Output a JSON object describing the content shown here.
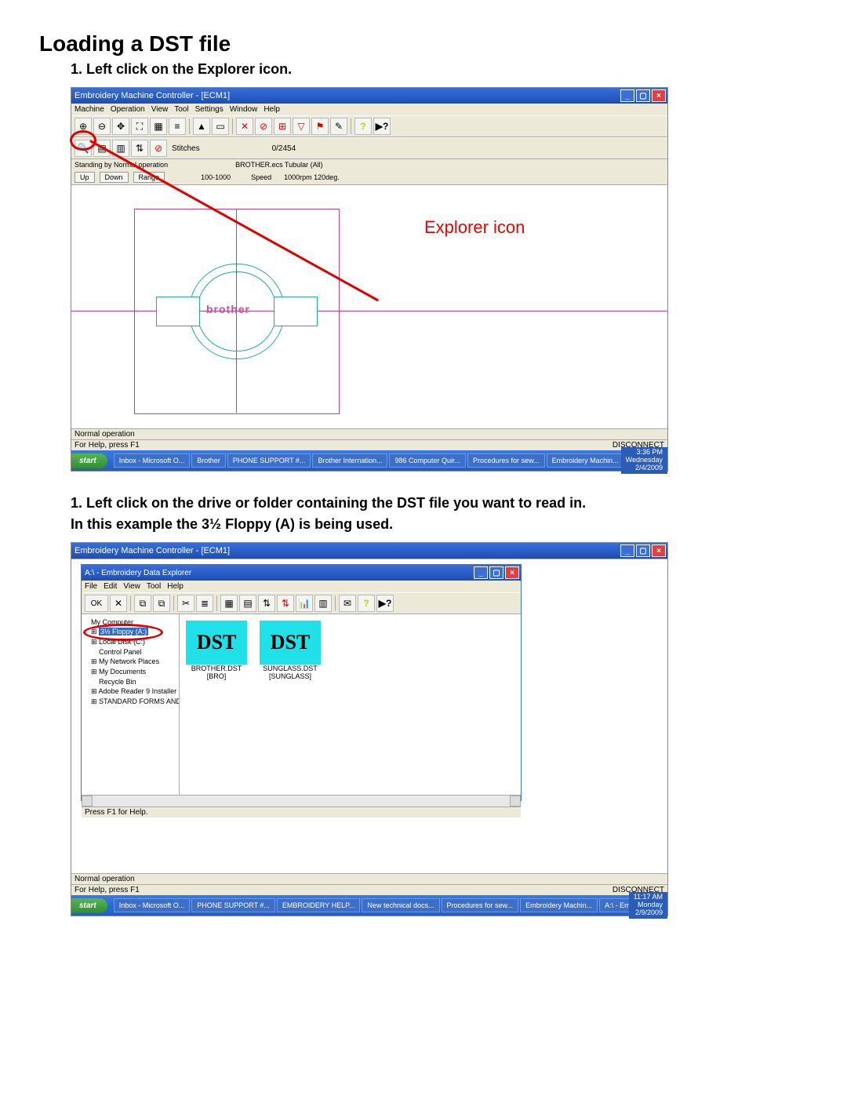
{
  "doc": {
    "title": "Loading a DST file",
    "step1": "1. Left click on the Explorer icon.",
    "step2a": "1. Left click on the drive or folder containing the DST file you want to read in.",
    "step2b": "In this example the 3½ Floppy (A) is being used."
  },
  "callout": {
    "explorer": "Explorer icon"
  },
  "shot1": {
    "title": "Embroidery Machine Controller - [ECM1]",
    "menus": [
      "Machine",
      "Operation",
      "View",
      "Tool",
      "Settings",
      "Window",
      "Help"
    ],
    "stitches_label": "Stitches",
    "stitches_value": "0/2454",
    "standing": "Standing by    Normal operation",
    "machine": "BROTHER.ecs Tubular (All)",
    "buttons": {
      "up": "Up",
      "down": "Down",
      "range": "Range"
    },
    "rpm_range": "100-1000",
    "speed_label": "Speed",
    "speed_value": "1000rpm 120deg.",
    "logo": "brother",
    "status1": "Normal operation",
    "status2": "For Help, press F1",
    "disconnect": "DISCONNECT"
  },
  "taskbar1": {
    "start": "start",
    "items": [
      "Inbox - Microsoft O...",
      "Brother",
      "PHONE SUPPORT #...",
      "Brother Internation...",
      "986 Computer Quir...",
      "Procedures for sew...",
      "Embroidery Machin..."
    ],
    "clock": {
      "time": "3:36 PM",
      "day": "Wednesday",
      "date": "2/4/2009"
    }
  },
  "shot2": {
    "outer_title": "Embroidery Machine Controller - [ECM1]",
    "inner_title": "A:\\ - Embroidery Data Explorer",
    "menus": [
      "File",
      "Edit",
      "View",
      "Tool",
      "Help"
    ],
    "ok": "OK",
    "tree": {
      "root": "My Computer",
      "floppy": "3½ Floppy (A:)",
      "local": "Local Disk (C:)",
      "panel": "Control Panel",
      "net": "My Network Places",
      "docs": "My Documents",
      "bin": "Recycle Bin",
      "adobe": "Adobe Reader 9 Installer",
      "forms": "STANDARD FORMS AND TEMPLAT"
    },
    "files": [
      {
        "icon": "DST",
        "name": "BROTHER.DST",
        "sub": "[BRO]"
      },
      {
        "icon": "DST",
        "name": "SUNGLASS.DST",
        "sub": "[SUNGLASS]"
      }
    ],
    "status": "Press F1 for Help.",
    "status1": "Normal operation",
    "status2": "For Help, press F1",
    "disconnect": "DISCONNECT"
  },
  "taskbar2": {
    "start": "start",
    "items": [
      "Inbox - Microsoft O...",
      "PHONE SUPPORT #...",
      "EMBROIDERY HELP...",
      "New technical docs...",
      "Procedures for sew...",
      "Embroidery Machin...",
      "A:\\ - Embroidery D..."
    ],
    "clock": {
      "time": "11:17 AM",
      "day": "Monday",
      "date": "2/9/2009"
    }
  }
}
